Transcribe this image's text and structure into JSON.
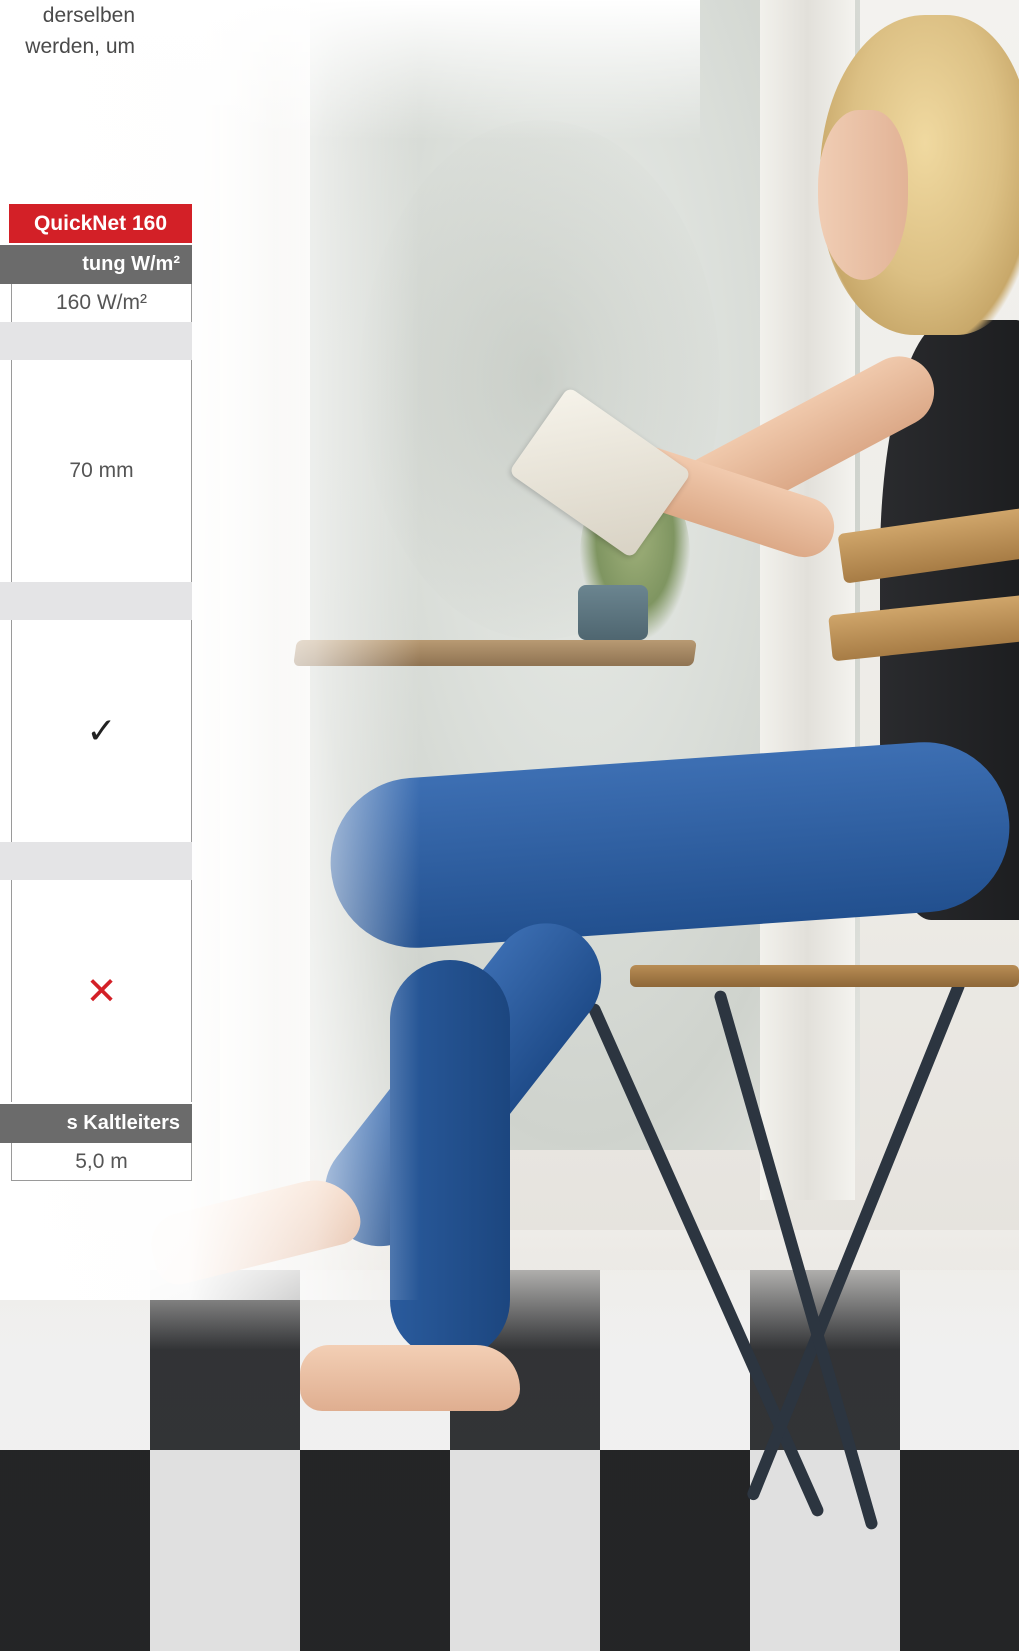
{
  "intro": {
    "line1": "derselben",
    "line2": "werden, um"
  },
  "table": {
    "header_product": "QuickNet 160",
    "section_power": "tung W/m²",
    "power_value": "160 W/m²",
    "height_value": "70 mm",
    "check_symbol": "✓",
    "cross_symbol": "✕",
    "section_cold_lead": "s Kaltleiters",
    "cold_lead_value": "5,0 m"
  },
  "colors": {
    "accent_red": "#d32027",
    "header_grey": "#6b6b6b",
    "band_grey": "#e4e4e6"
  }
}
